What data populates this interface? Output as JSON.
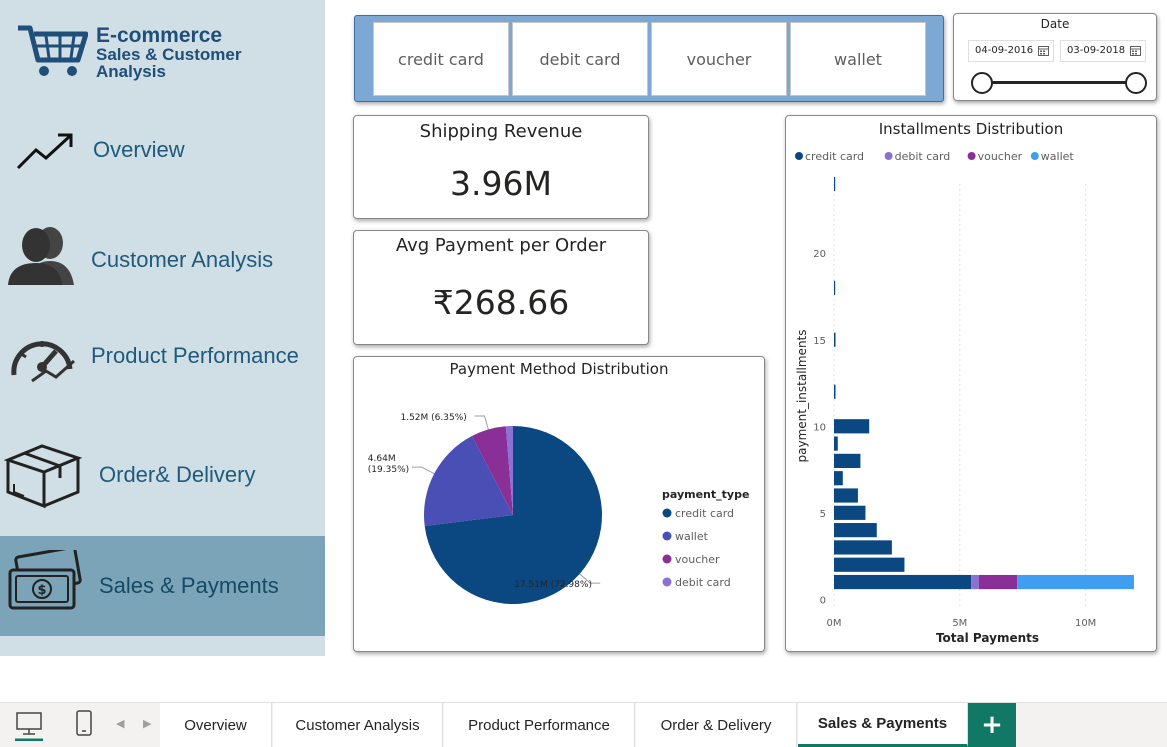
{
  "logo": {
    "line1": "E-commerce",
    "line2": "Sales & Customer",
    "line3": "Analysis"
  },
  "nav": [
    {
      "label": "Overview",
      "icon": "trend-arrow-icon"
    },
    {
      "label": "Customer Analysis",
      "icon": "users-icon"
    },
    {
      "label": "Product Performance",
      "icon": "speedometer-icon"
    },
    {
      "label": "Order& Delivery",
      "icon": "package-box-icon"
    },
    {
      "label": "Sales & Payments",
      "icon": "money-icon",
      "active": true
    }
  ],
  "slicer": {
    "options": [
      "credit card",
      "debit card",
      "voucher",
      "wallet"
    ]
  },
  "date_filter": {
    "title": "Date",
    "start": "04-09-2016",
    "end": "03-09-2018"
  },
  "kpis": {
    "shipping_revenue": {
      "title": "Shipping Revenue",
      "value": "3.96M"
    },
    "avg_payment": {
      "title": "Avg Payment per Order",
      "value": "₹268.66"
    }
  },
  "chart_data": [
    {
      "type": "pie",
      "title": "Payment Method Distribution",
      "legend_title": "payment_type",
      "legend_position": "right",
      "slices": [
        {
          "name": "credit card",
          "value": 17.51,
          "label": "17.51M (72.98%)",
          "color": "#0b4781"
        },
        {
          "name": "wallet",
          "value": 4.64,
          "label": "4.64M (19.35%)",
          "color": "#4a4fb5"
        },
        {
          "name": "voucher",
          "value": 1.52,
          "label": "1.52M (6.35%)",
          "color": "#8a2f97"
        },
        {
          "name": "debit card",
          "value": 0.31,
          "label": "",
          "color": "#8b71d1"
        }
      ]
    },
    {
      "type": "bar",
      "orientation": "horizontal",
      "stacked": true,
      "title": "Installments Distribution",
      "xlabel": "Total Payments",
      "ylabel": "payment_installments",
      "legend_position": "top-left",
      "xlim": [
        0,
        12.2
      ],
      "ylim": [
        -0.5,
        24
      ],
      "x_ticks": [
        {
          "v": 0,
          "label": "0M"
        },
        {
          "v": 5,
          "label": "5M"
        },
        {
          "v": 10,
          "label": "10M"
        }
      ],
      "y_ticks": [
        0,
        5,
        10,
        15,
        20
      ],
      "grid": true,
      "series": [
        {
          "name": "credit card",
          "color": "#0b4781",
          "points": [
            [
              1,
              5.45
            ],
            [
              2,
              2.8
            ],
            [
              3,
              2.3
            ],
            [
              4,
              1.7
            ],
            [
              5,
              1.25
            ],
            [
              6,
              0.95
            ],
            [
              7,
              0.35
            ],
            [
              8,
              1.05
            ],
            [
              9,
              0.15
            ],
            [
              10,
              1.4
            ],
            [
              12,
              0.06
            ],
            [
              15,
              0.06
            ],
            [
              18,
              0.03
            ],
            [
              24,
              0.03
            ]
          ]
        },
        {
          "name": "debit card",
          "color": "#8b71d1",
          "points": [
            [
              1,
              0.31
            ]
          ]
        },
        {
          "name": "voucher",
          "color": "#8a2f97",
          "points": [
            [
              1,
              1.52
            ]
          ]
        },
        {
          "name": "wallet",
          "color": "#3f9ef0",
          "points": [
            [
              1,
              4.64
            ]
          ]
        }
      ]
    }
  ],
  "tabs": [
    {
      "label": "Overview"
    },
    {
      "label": "Customer Analysis"
    },
    {
      "label": "Product Performance"
    },
    {
      "label": "Order & Delivery"
    },
    {
      "label": "Sales & Payments",
      "active": true
    }
  ],
  "add_tab": "+",
  "colors": {
    "sidebar_bg": "#d0dfe6",
    "sidebar_active": "#7ba4b8",
    "accent": "#117865",
    "slicer_bg": "#7ea8d4"
  }
}
